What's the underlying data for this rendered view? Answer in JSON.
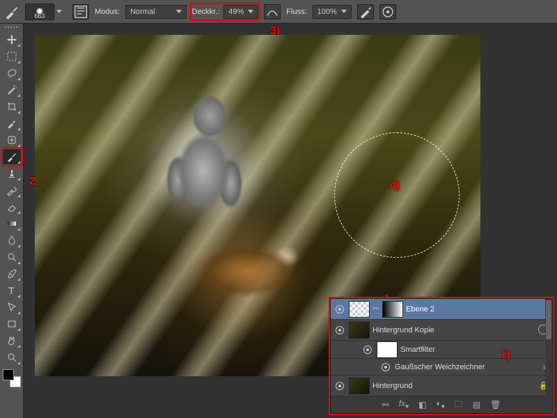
{
  "options_bar": {
    "tool_icon": "brush",
    "brush_size": "663",
    "mode_label": "Modus:",
    "mode_value": "Normal",
    "opacity_label": "Deckkr.:",
    "opacity_value": "49%",
    "flow_label": "Fluss:",
    "flow_value": "100%"
  },
  "tools": [
    {
      "name": "move-tool",
      "icon": "move"
    },
    {
      "name": "marquee-tool",
      "icon": "marquee"
    },
    {
      "name": "lasso-tool",
      "icon": "lasso"
    },
    {
      "name": "magic-wand-tool",
      "icon": "wand"
    },
    {
      "name": "crop-tool",
      "icon": "crop"
    },
    {
      "name": "eyedropper-tool",
      "icon": "eyedropper"
    },
    {
      "name": "healing-brush-tool",
      "icon": "heal"
    },
    {
      "name": "brush-tool",
      "icon": "brush",
      "active": true,
      "highlight": true
    },
    {
      "name": "clone-stamp-tool",
      "icon": "stamp"
    },
    {
      "name": "history-brush-tool",
      "icon": "history"
    },
    {
      "name": "eraser-tool",
      "icon": "eraser"
    },
    {
      "name": "gradient-tool",
      "icon": "gradient"
    },
    {
      "name": "blur-tool",
      "icon": "blur"
    },
    {
      "name": "dodge-tool",
      "icon": "dodge"
    },
    {
      "name": "pen-tool",
      "icon": "pen"
    },
    {
      "name": "type-tool",
      "icon": "type"
    },
    {
      "name": "path-selection-tool",
      "icon": "pathsel"
    },
    {
      "name": "rectangle-tool",
      "icon": "rect"
    },
    {
      "name": "hand-tool",
      "icon": "hand"
    },
    {
      "name": "zoom-tool",
      "icon": "zoom"
    }
  ],
  "layers": [
    {
      "name": "Ebene 2",
      "selected": true,
      "thumb": "checker",
      "mask": "grad"
    },
    {
      "name": "Hintergrund Kopie",
      "thumb": "art",
      "smart": true
    },
    {
      "name": "Smartfilter",
      "sub": true,
      "thumb": "mask"
    },
    {
      "name": "Gaußscher Weichzeichner",
      "sub2": true
    },
    {
      "name": "Hintergrund",
      "thumb": "art",
      "locked": true
    }
  ],
  "footer_icons": [
    "link",
    "fx",
    "mask",
    "adjust",
    "group",
    "new",
    "trash"
  ],
  "annotations": {
    "a1": "1)",
    "a2": "2)",
    "a3": "3)",
    "a4": "4)"
  }
}
